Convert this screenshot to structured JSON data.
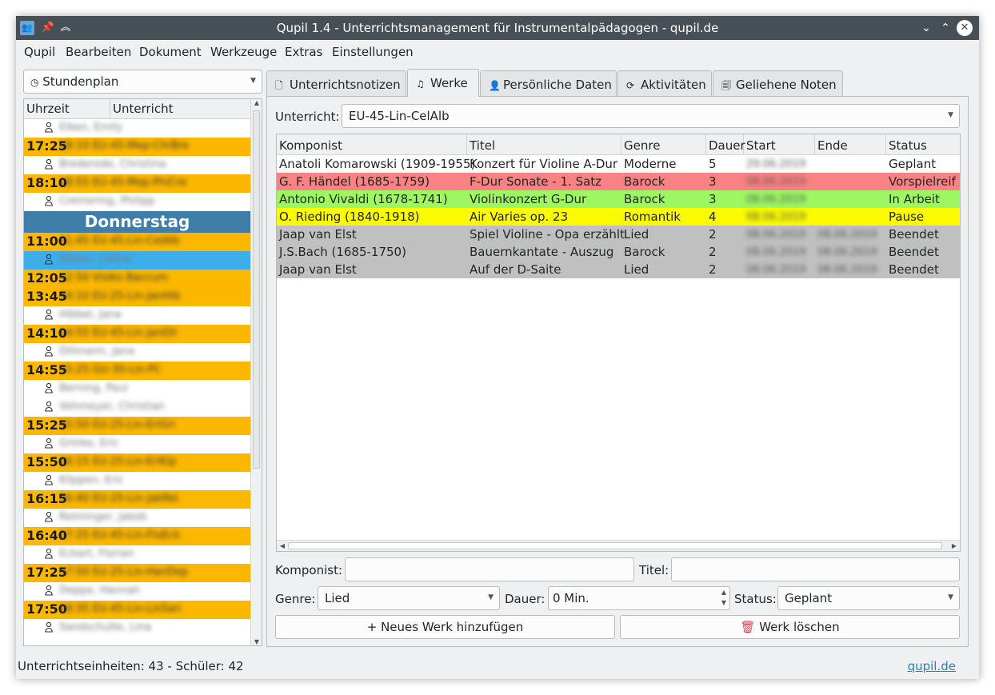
{
  "window": {
    "title": "Qupil 1.4 - Unterrichtsmanagement für Instrumentalpädagogen - qupil.de"
  },
  "menu": [
    "Qupil",
    "Bearbeiten",
    "Dokument",
    "Werkzeuge",
    "Extras",
    "Einstellungen"
  ],
  "left": {
    "view_select": "Stundenplan",
    "columns": [
      "Uhrzeit",
      "Unterricht"
    ],
    "day_label": "Donnerstag",
    "rows": [
      {
        "type": "student",
        "name": "Eiken, Emily"
      },
      {
        "type": "time",
        "time": "17:25",
        "info": "18:10  EU-45-Mep-ChrBre"
      },
      {
        "type": "student",
        "name": "Brederode, Christina"
      },
      {
        "type": "time",
        "time": "18:10",
        "info": "18:55  EU-45-Mep-PhiCre"
      },
      {
        "type": "student",
        "name": "Cremering, Philipp"
      },
      {
        "type": "day"
      },
      {
        "type": "time",
        "time": "11:00",
        "info": "11:45  EU-45-Lin-CelAlb"
      },
      {
        "type": "student",
        "name": "Albers, Celine",
        "selected": true
      },
      {
        "type": "time",
        "time": "12:05",
        "info": "12:50  Violks Baccum"
      },
      {
        "type": "time",
        "time": "13:45",
        "info": "14:10  EU-25-Lin-JanHib"
      },
      {
        "type": "student",
        "name": "Hibbel, Jana"
      },
      {
        "type": "time",
        "time": "14:10",
        "info": "14:55  EU-45-Lin-JanDil"
      },
      {
        "type": "student",
        "name": "Dillmann, Jana"
      },
      {
        "type": "time",
        "time": "14:55",
        "info": "15:25  GU-30-Lin-PC"
      },
      {
        "type": "student",
        "name": "Berning, Paul"
      },
      {
        "type": "student",
        "name": "Vehmeyer, Christian"
      },
      {
        "type": "time",
        "time": "15:25",
        "info": "15:50  EU-25-Lin-EriGri"
      },
      {
        "type": "student",
        "name": "Grinke, Eric"
      },
      {
        "type": "time",
        "time": "15:50",
        "info": "16:15  EU-25-Lin-EriKlp"
      },
      {
        "type": "student",
        "name": "Klippen, Eric"
      },
      {
        "type": "time",
        "time": "16:15",
        "info": "16:40  EU-25-Lin-JakRei"
      },
      {
        "type": "student",
        "name": "Reiminger, Jakob"
      },
      {
        "type": "time",
        "time": "16:40",
        "info": "17:25  EU-45-Lin-FloEck"
      },
      {
        "type": "student",
        "name": "Eckart, Florian"
      },
      {
        "type": "time",
        "time": "17:25",
        "info": "17:50  EU-25-Lin-HanDep"
      },
      {
        "type": "student",
        "name": "Deppe, Hannah"
      },
      {
        "type": "time",
        "time": "17:50",
        "info": "18:35  EU-45-Lin-LinSan"
      },
      {
        "type": "student",
        "name": "Sandschulte, Lina"
      }
    ]
  },
  "tabs": [
    {
      "label": "Unterrichtsnotizen",
      "icon": "note-icon",
      "glyph": "🗋"
    },
    {
      "label": "Werke",
      "icon": "music-note-icon",
      "glyph": "♫",
      "active": true
    },
    {
      "label": "Persönliche Daten",
      "icon": "person-icon",
      "glyph": "👤"
    },
    {
      "label": "Aktivitäten",
      "icon": "refresh-icon",
      "glyph": "⟳"
    },
    {
      "label": "Geliehene Noten",
      "icon": "sheet-icon",
      "glyph": "🗐"
    }
  ],
  "werke": {
    "lesson_label": "Unterricht:",
    "lesson_value": "EU-45-Lin-CelAlb",
    "columns": [
      "Komponist",
      "Titel",
      "Genre",
      "Dauer",
      "Start",
      "Ende",
      "Status"
    ],
    "rows": [
      {
        "komponist": "Anatoli Komarowski (1909-1955)",
        "titel": "Konzert für Violine A-Dur",
        "genre": "Moderne",
        "dauer": "5",
        "start": "29.06.2019",
        "ende": "",
        "status": "Geplant",
        "color": "#ffffff"
      },
      {
        "komponist": "G. F. Händel (1685-1759)",
        "titel": "F-Dur Sonate - 1. Satz",
        "genre": "Barock",
        "dauer": "3",
        "start": "08.06.2019",
        "ende": "",
        "status": "Vorspielreif",
        "color": "#f98282"
      },
      {
        "komponist": "Antonio Vivaldi (1678-1741)",
        "titel": "Violinkonzert G-Dur",
        "genre": "Barock",
        "dauer": "3",
        "start": "08.06.2019",
        "ende": "",
        "status": "In Arbeit",
        "color": "#9cf762"
      },
      {
        "komponist": "O. Rieding (1840-1918)",
        "titel": "Air Varies op. 23",
        "genre": "Romantik",
        "dauer": "4",
        "start": "08.06.2019",
        "ende": "",
        "status": "Pause",
        "color": "#fafb00"
      },
      {
        "komponist": "Jaap van Elst",
        "titel": "Spiel Violine - Opa erzählt",
        "genre": "Lied",
        "dauer": "2",
        "start": "08.06.2019",
        "ende": "08.06.2019",
        "status": "Beendet",
        "color": "#c0c0c0"
      },
      {
        "komponist": "J.S.Bach (1685-1750)",
        "titel": "Bauernkantate - Auszug",
        "genre": "Barock",
        "dauer": "2",
        "start": "08.06.2019",
        "ende": "08.06.2019",
        "status": "Beendet",
        "color": "#c0c0c0"
      },
      {
        "komponist": "Jaap van Elst",
        "titel": "Auf der D-Saite",
        "genre": "Lied",
        "dauer": "2",
        "start": "08.06.2019",
        "ende": "08.06.2019",
        "status": "Beendet",
        "color": "#c0c0c0"
      }
    ],
    "form": {
      "komponist_label": "Komponist:",
      "komponist_value": "",
      "titel_label": "Titel:",
      "titel_value": "",
      "genre_label": "Genre:",
      "genre_value": "Lied",
      "dauer_label": "Dauer:",
      "dauer_value": "0 Min.",
      "status_label": "Status:",
      "status_value": "Geplant",
      "add_button": "Neues Werk hinzufügen",
      "delete_button": "Werk löschen"
    }
  },
  "statusbar": {
    "text": "Unterrichtseinheiten: 43 - Schüler: 42",
    "link": "qupil.de"
  }
}
